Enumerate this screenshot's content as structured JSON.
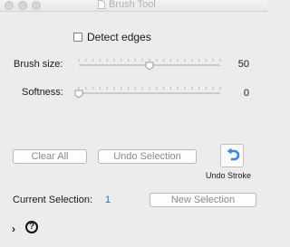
{
  "window": {
    "title": "Brush Tool"
  },
  "detect_edges": {
    "label": "Detect edges",
    "checked": false
  },
  "brush_size": {
    "label": "Brush size:",
    "value": "50",
    "fraction": 0.5
  },
  "softness": {
    "label": "Softness:",
    "value": "0",
    "fraction": 0.0
  },
  "buttons": {
    "clear_all": "Clear All",
    "undo_selection": "Undo Selection",
    "new_selection": "New Selection",
    "undo_stroke": "Undo Stroke"
  },
  "current_selection": {
    "label": "Current Selection:",
    "count": "1"
  },
  "colors": {
    "accent": "#2a6fd6",
    "undo_icon": "#3d86e8"
  },
  "icons": [
    "document-icon",
    "undo-arrow-icon",
    "chevron-right-icon",
    "help-icon"
  ]
}
